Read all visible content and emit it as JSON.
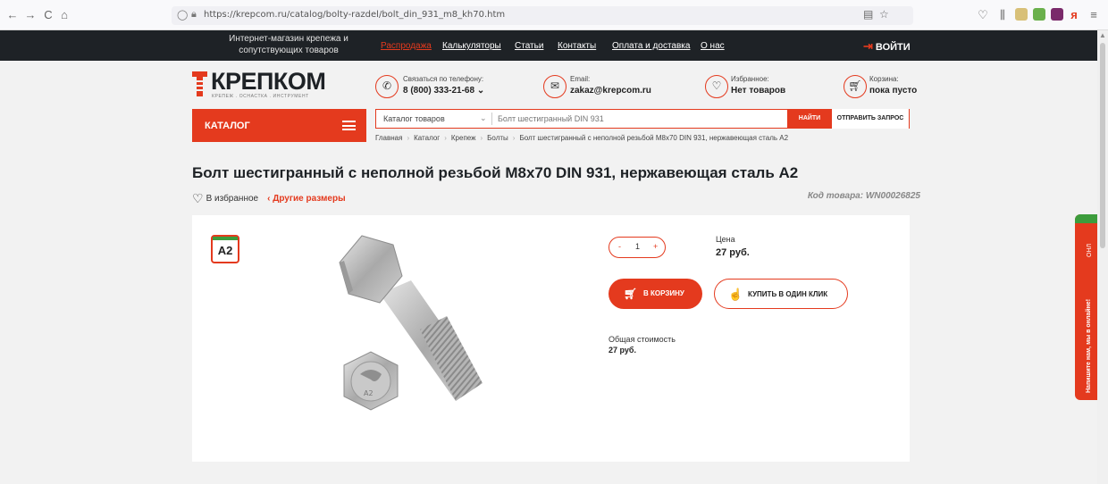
{
  "browser": {
    "back": "←",
    "forward": "→",
    "reload": "C",
    "home": "⌂",
    "url": "https://krepcom.ru/catalog/bolty-razdel/bolt_din_931_m8_kh70.htm"
  },
  "top_nav": {
    "tagline": "Интернет-магазин крепежа и сопутствующих товаров",
    "links": [
      "Распродажа",
      "Калькуляторы",
      "Статьи",
      "Контакты",
      "Оплата и доставка",
      "О нас"
    ],
    "login": "ВОЙТИ"
  },
  "logo": {
    "name": "КРЕПКОМ",
    "subtitle": "КРЕПЕЖ . ОСНАСТКА . ИНСТРУМЕНТ"
  },
  "contacts": {
    "phone_label": "Связаться по телефону:",
    "phone_value": "8 (800) 333-21-68 ⌄",
    "email_label": "Email:",
    "email_value": "zakaz@krepcom.ru",
    "fav_label": "Избранное:",
    "fav_value": "Нет товаров",
    "cart_label": "Корзина:",
    "cart_value": "пока пусто"
  },
  "catalog": {
    "label": "КАТАЛОГ"
  },
  "search": {
    "category": "Каталог товаров",
    "placeholder": "Болт шестигранный DIN 931",
    "button": "НАЙТИ",
    "request": "ОТПРАВИТЬ ЗАПРОС"
  },
  "breadcrumb": [
    "Главная",
    "Каталог",
    "Крепеж",
    "Болты",
    "Болт шестигранный с неполной резьбой M8x70 DIN 931, нержавеющая сталь А2"
  ],
  "product": {
    "title": "Болт шестигранный с неполной резьбой M8x70 DIN 931, нержавеющая сталь А2",
    "favorite": "В избранное",
    "other_sizes": "‹ Другие размеры",
    "sku": "Код товара: WN00026825",
    "badge": "A2",
    "qty_minus": "-",
    "qty": "1",
    "qty_plus": "+",
    "price_label": "Цена",
    "price": "27 руб.",
    "cart_button": "В КОРЗИНУ",
    "oneclick_button": "КУПИТЬ В ОДИН КЛИК",
    "total_label": "Общая стоимость",
    "total": "27 руб."
  },
  "chat": {
    "text": "Напишите нам, мы в онлайне!",
    "online": "ОНЛ"
  },
  "colors": {
    "accent": "#e43a1e",
    "dark": "#1e2226",
    "green": "#3c9c3c"
  }
}
